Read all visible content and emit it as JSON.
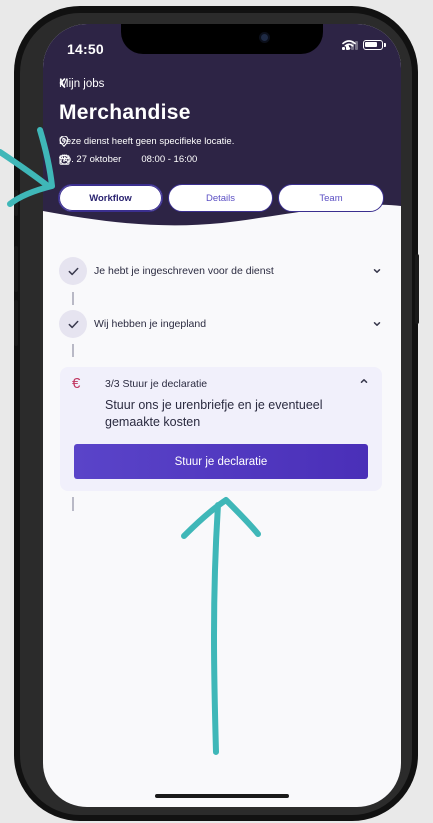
{
  "status_bar": {
    "time": "14:50"
  },
  "header": {
    "back_label": "Mijn jobs",
    "title": "Merchandise",
    "location_text": "Deze dienst heeft geen specifieke locatie.",
    "date_text": "wo. 27 oktober",
    "time_text": "08:00 - 16:00"
  },
  "tabs": [
    {
      "label": "Workflow",
      "active": true
    },
    {
      "label": "Details",
      "active": false
    },
    {
      "label": "Team",
      "active": false
    }
  ],
  "workflow": {
    "steps": [
      {
        "label": "Je hebt je ingeschreven voor de dienst",
        "completed": true
      },
      {
        "label": "Wij hebben je ingepland",
        "completed": true
      }
    ],
    "active_step": {
      "title": "3/3 Stuur je declaratie",
      "description": "Stuur ons je urenbriefje en je eventueel gemaakte kosten",
      "button_label": "Stuur je declaratie",
      "icon_symbol": "€"
    }
  },
  "colors": {
    "header_bg": "#2d2445",
    "accent": "#4f38bd",
    "tab_border": "#3b2f8f",
    "euro_icon": "#c0335e",
    "annotation_arrow": "#3fb7b8"
  }
}
